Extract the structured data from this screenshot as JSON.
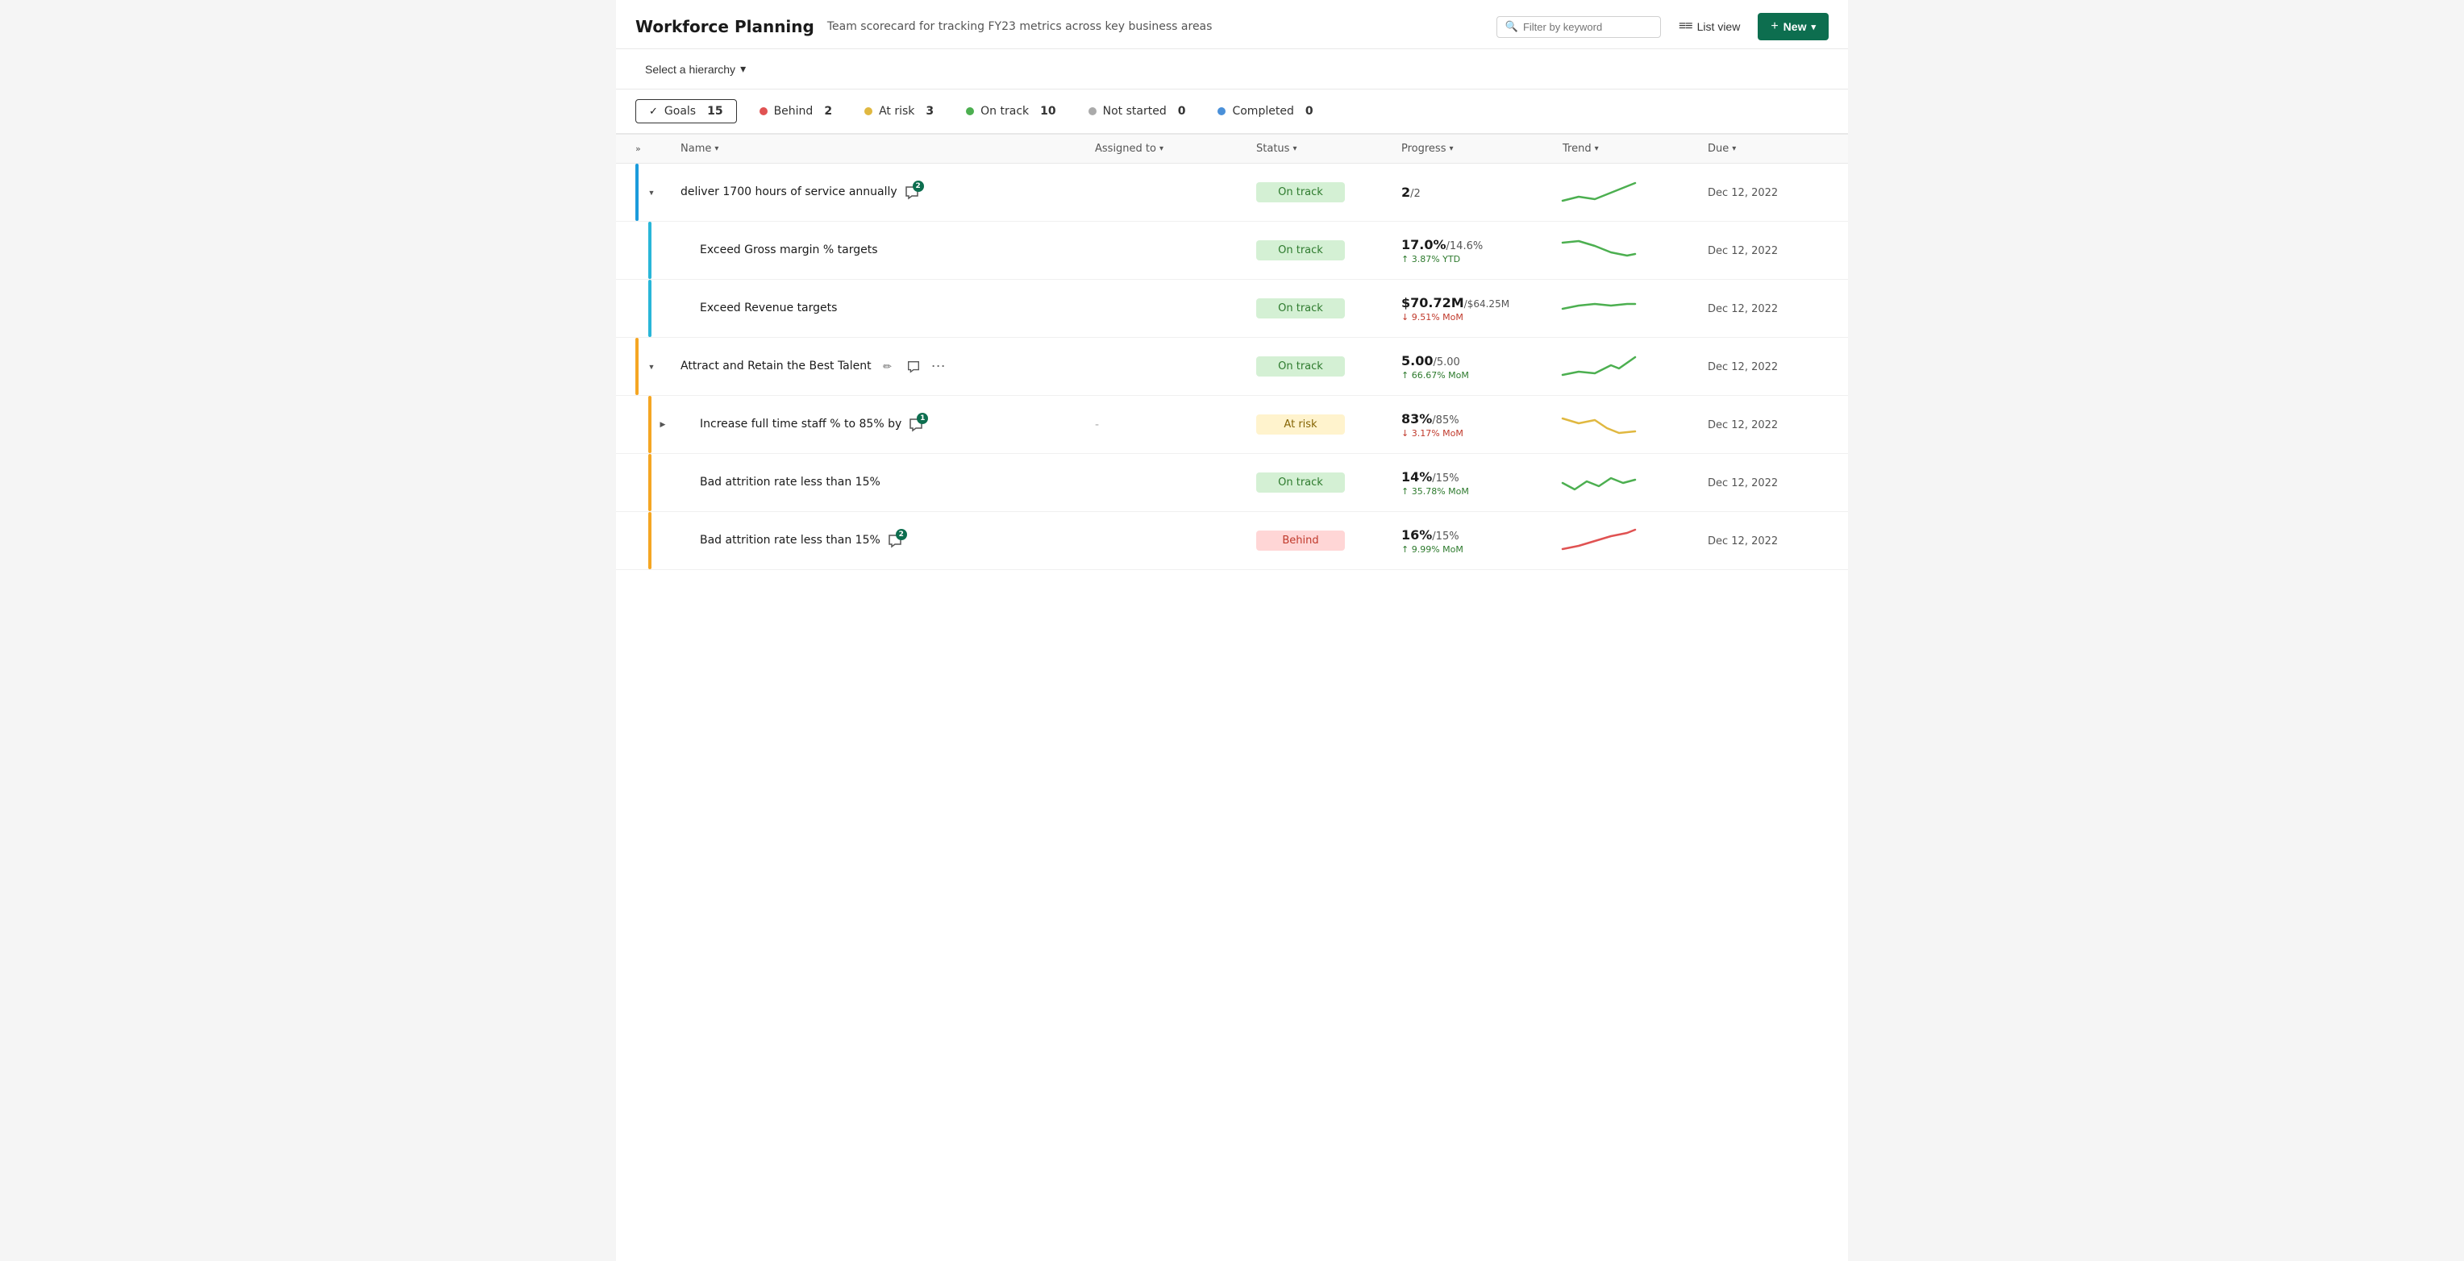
{
  "header": {
    "title": "Workforce Planning",
    "subtitle": "Team scorecard for tracking FY23 metrics across key business areas",
    "filter_placeholder": "Filter by keyword",
    "list_view_label": "List view",
    "new_label": "+ New"
  },
  "toolbar": {
    "hierarchy_label": "Select a hierarchy",
    "chevron": "▾"
  },
  "stats": [
    {
      "id": "goals",
      "icon": "check",
      "label": "Goals",
      "count": "15",
      "dot_color": null
    },
    {
      "id": "behind",
      "label": "Behind",
      "count": "2",
      "dot_color": "#e05252"
    },
    {
      "id": "at-risk",
      "label": "At risk",
      "count": "3",
      "dot_color": "#e0b840"
    },
    {
      "id": "on-track",
      "label": "On track",
      "count": "10",
      "dot_color": "#4caf50"
    },
    {
      "id": "not-started",
      "label": "Not started",
      "count": "0",
      "dot_color": "#aaa"
    },
    {
      "id": "completed",
      "label": "Completed",
      "count": "0",
      "dot_color": "#4a90d9"
    }
  ],
  "columns": [
    {
      "id": "expand",
      "label": ""
    },
    {
      "id": "name",
      "label": "Name"
    },
    {
      "id": "assigned",
      "label": "Assigned to"
    },
    {
      "id": "status",
      "label": "Status"
    },
    {
      "id": "progress",
      "label": "Progress"
    },
    {
      "id": "trend",
      "label": "Trend"
    },
    {
      "id": "due",
      "label": "Due"
    }
  ],
  "rows": [
    {
      "id": "row1",
      "indent": 0,
      "bar_color": "bar-blue",
      "expand": "down",
      "name": "deliver 1700 hours of service annually",
      "has_comment": true,
      "comment_count": "2",
      "assigned": "",
      "status": "On track",
      "status_class": "status-on-track",
      "progress_main": "2",
      "progress_target": "/2",
      "progress_sub": "",
      "progress_up": false,
      "due": "Dec 12, 2022",
      "trend_type": "up-green",
      "show_actions": false
    },
    {
      "id": "row2",
      "indent": 1,
      "bar_color": "bar-cyan",
      "expand": "none",
      "name": "Exceed Gross margin % targets",
      "has_comment": false,
      "comment_count": "",
      "assigned": "",
      "status": "On track",
      "status_class": "status-on-track",
      "progress_main": "17.0%",
      "progress_target": "/14.6%",
      "progress_sub": "↑ 3.87% YTD",
      "progress_up": true,
      "due": "Dec 12, 2022",
      "trend_type": "down-green",
      "show_actions": false
    },
    {
      "id": "row3",
      "indent": 1,
      "bar_color": "bar-cyan",
      "expand": "none",
      "name": "Exceed Revenue targets",
      "has_comment": false,
      "comment_count": "",
      "assigned": "",
      "status": "On track",
      "status_class": "status-on-track",
      "progress_main": "$70.72M",
      "progress_target": "/$64.25M",
      "progress_sub": "↓ 9.51% MoM",
      "progress_up": false,
      "due": "Dec 12, 2022",
      "trend_type": "flat-green",
      "show_actions": false
    },
    {
      "id": "row4",
      "indent": 0,
      "bar_color": "bar-orange",
      "expand": "down",
      "name": "Attract and Retain the Best Talent",
      "has_comment": false,
      "comment_count": "",
      "assigned": "",
      "status": "On track",
      "status_class": "status-on-track",
      "progress_main": "5.00",
      "progress_target": "/5.00",
      "progress_sub": "↑ 66.67% MoM",
      "progress_up": true,
      "due": "Dec 12, 2022",
      "trend_type": "up-green2",
      "show_actions": true
    },
    {
      "id": "row5",
      "indent": 1,
      "bar_color": "bar-orange",
      "expand": "right",
      "name": "Increase full time staff % to 85% by",
      "has_comment": true,
      "comment_count": "1",
      "assigned": "-",
      "status": "At risk",
      "status_class": "status-at-risk",
      "progress_main": "83%",
      "progress_target": "/85%",
      "progress_sub": "↓ 3.17% MoM",
      "progress_up": false,
      "due": "Dec 12, 2022",
      "trend_type": "down-yellow",
      "show_actions": false
    },
    {
      "id": "row6",
      "indent": 1,
      "bar_color": "bar-orange",
      "expand": "none",
      "name": "Bad attrition rate less than 15%",
      "has_comment": false,
      "comment_count": "",
      "assigned": "",
      "status": "On track",
      "status_class": "status-on-track",
      "progress_main": "14%",
      "progress_target": "/15%",
      "progress_sub": "↑ 35.78% MoM",
      "progress_up": true,
      "due": "Dec 12, 2022",
      "trend_type": "wave-green",
      "show_actions": false
    },
    {
      "id": "row7",
      "indent": 1,
      "bar_color": "bar-orange",
      "expand": "none",
      "name": "Bad attrition rate less than 15%",
      "has_comment": true,
      "comment_count": "2",
      "assigned": "",
      "status": "Behind",
      "status_class": "status-behind",
      "progress_main": "16%",
      "progress_target": "/15%",
      "progress_sub": "↑ 9.99% MoM",
      "progress_up": true,
      "due": "Dec 12, 2022",
      "trend_type": "up-red",
      "show_actions": false
    }
  ],
  "icons": {
    "search": "🔍",
    "list_view": "≡",
    "plus": "+",
    "chevron_down": "▾",
    "chevron_right": "›",
    "expand_down": "▼",
    "expand_right": "▶",
    "comment": "💬",
    "pencil": "✏",
    "more": "⋯",
    "check": "✓"
  },
  "colors": {
    "brand_green": "#0d6e4f",
    "on_track_bg": "#d4f0d4",
    "on_track_text": "#2d7a2d",
    "at_risk_bg": "#fff3cd",
    "at_risk_text": "#856404",
    "behind_bg": "#ffd6d6",
    "behind_text": "#c0392b"
  }
}
